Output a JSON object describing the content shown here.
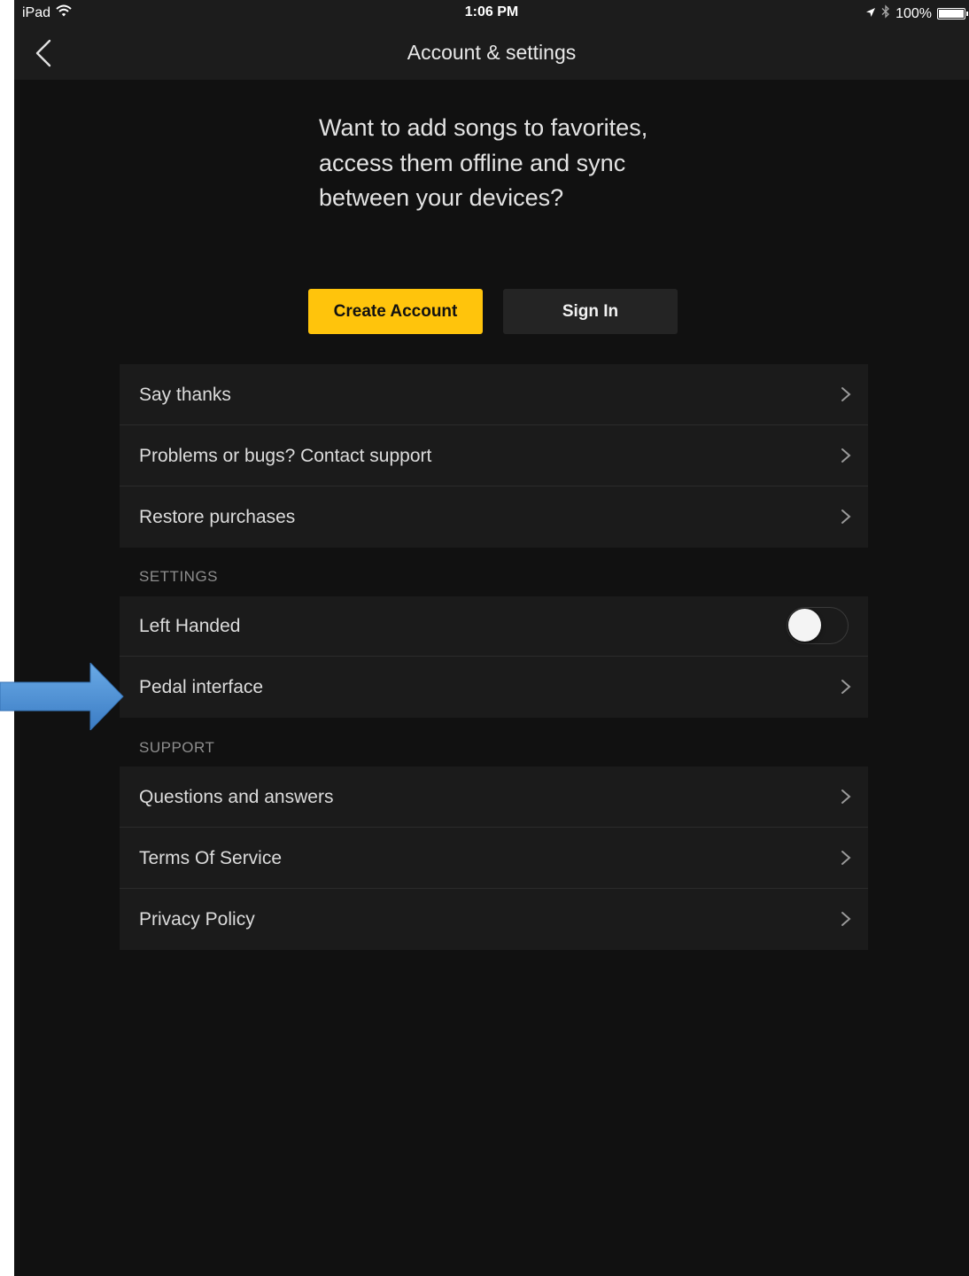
{
  "status_bar": {
    "device": "iPad",
    "time": "1:06 PM",
    "battery": "100%"
  },
  "nav": {
    "title": "Account & settings",
    "back_icon": "chevron-left-icon"
  },
  "promo": {
    "text": "Want to add songs to favorites, access them offline and sync between your devices?",
    "create_account_label": "Create Account",
    "sign_in_label": "Sign In"
  },
  "account_list": {
    "items": [
      {
        "label": "Say thanks"
      },
      {
        "label": "Problems or bugs? Contact support"
      },
      {
        "label": "Restore purchases"
      }
    ]
  },
  "settings": {
    "header": "SETTINGS",
    "left_handed": {
      "label": "Left Handed",
      "enabled": false
    },
    "pedal": {
      "label": "Pedal interface"
    }
  },
  "support": {
    "header": "SUPPORT",
    "items": [
      {
        "label": "Questions and answers"
      },
      {
        "label": "Terms Of Service"
      },
      {
        "label": "Privacy Policy"
      }
    ]
  },
  "colors": {
    "accent": "#ffc40c",
    "background": "#111111",
    "row_background": "#1b1b1b",
    "annotation_arrow": "#4a8fd4"
  }
}
